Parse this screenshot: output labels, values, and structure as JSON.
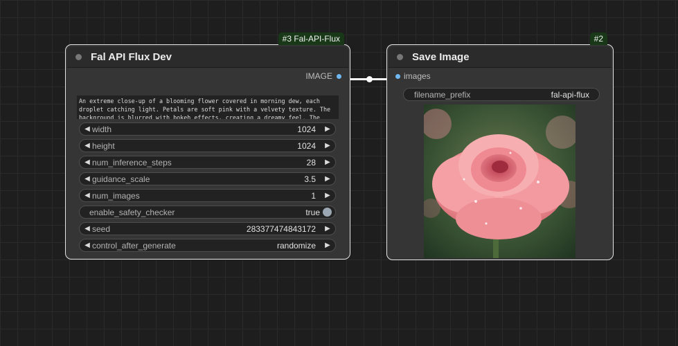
{
  "nodes": {
    "fal": {
      "badge": "#3 Fal-API-Flux",
      "title": "Fal API Flux Dev",
      "output_label": "IMAGE",
      "prompt": "An extreme close-up of a blooming flower covered in morning dew, each droplet catching light. Petals are soft pink with a velvety texture. The background is blurred with bokeh effects, creating a dreamy feel. The image feels fresh",
      "widgets": [
        {
          "name": "width",
          "value": "1024"
        },
        {
          "name": "height",
          "value": "1024"
        },
        {
          "name": "num_inference_steps",
          "value": "28"
        },
        {
          "name": "guidance_scale",
          "value": "3.5"
        },
        {
          "name": "num_images",
          "value": "1"
        },
        {
          "name": "enable_safety_checker",
          "value": "true"
        },
        {
          "name": "seed",
          "value": "283377474843172"
        },
        {
          "name": "control_after_generate",
          "value": "randomize"
        }
      ]
    },
    "save": {
      "badge": "#2",
      "title": "Save Image",
      "input_label": "images",
      "filename_prefix_label": "filename_prefix",
      "filename_prefix_value": "fal-api-flux",
      "preview_icon": "pink-rose-image"
    }
  },
  "colors": {
    "canvas": "#1e1e1e",
    "node_body": "#353535",
    "badge": "#183818",
    "slot": "#6fb8f2",
    "link": "#ffffff"
  }
}
